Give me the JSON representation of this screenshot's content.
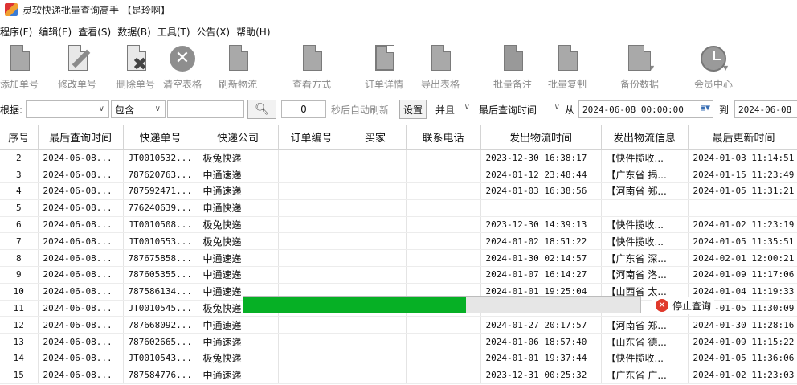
{
  "window": {
    "title": "灵软快递批量查询高手 【是玲啊】"
  },
  "menu": [
    "程序(F)",
    "编辑(E)",
    "查看(S)",
    "数据(B)",
    "工具(T)",
    "公告(X)",
    "帮助(H)"
  ],
  "toolbar": {
    "buttons": [
      {
        "label": "添加单号",
        "icon": "add-document-icon"
      },
      {
        "label": "修改单号",
        "icon": "edit-pencil-icon"
      },
      {
        "label": "删除单号",
        "icon": "delete-document-icon"
      },
      {
        "label": "清空表格",
        "icon": "clear-circle-x-icon"
      },
      {
        "label": "刷新物流",
        "icon": "refresh-document-icon"
      },
      {
        "label": "查看方式",
        "icon": "view-mode-icon"
      },
      {
        "label": "订单详情",
        "icon": "order-detail-icon"
      },
      {
        "label": "导出表格",
        "icon": "export-table-icon"
      },
      {
        "label": "批量备注",
        "icon": "batch-note-icon"
      },
      {
        "label": "批量复制",
        "icon": "batch-copy-icon"
      },
      {
        "label": "备份数据",
        "icon": "backup-icon"
      },
      {
        "label": "会员中心",
        "icon": "member-clock-icon"
      }
    ]
  },
  "filter": {
    "label": "根据:",
    "field_value": "",
    "match_mode": "包含",
    "keyword": "",
    "search_icon": "search-icon",
    "seconds": "0",
    "auto_refresh_label": "秒后自动刷新",
    "settings_label": "设置",
    "logic": "并且",
    "time_field": "最后查询时间",
    "from_label": "从",
    "from_value": "2024-06-08 00:00:00",
    "to_label": "到",
    "to_value": "2024-06-08"
  },
  "table": {
    "columns": [
      "序号",
      "最后查询时间",
      "快递单号",
      "快递公司",
      "订单编号",
      "买家",
      "联系电话",
      "发出物流时间",
      "发出物流信息",
      "最后更新时间"
    ],
    "rows": [
      [
        "2",
        "2024-06-08...",
        "JT0010532...",
        "极兔快递",
        "",
        "",
        "",
        "2023-12-30 16:38:17",
        "【快件揽收...",
        "2024-01-03 11:14:51"
      ],
      [
        "3",
        "2024-06-08...",
        "787620763...",
        "中通速递",
        "",
        "",
        "",
        "2024-01-12 23:48:44",
        "【广东省 揭...",
        "2024-01-15 11:23:49"
      ],
      [
        "4",
        "2024-06-08...",
        "787592471...",
        "中通速递",
        "",
        "",
        "",
        "2024-01-03 16:38:56",
        "【河南省 郑...",
        "2024-01-05 11:31:21"
      ],
      [
        "5",
        "2024-06-08...",
        "776240639...",
        "申通快递",
        "",
        "",
        "",
        "",
        "",
        ""
      ],
      [
        "6",
        "2024-06-08...",
        "JT0010508...",
        "极兔快递",
        "",
        "",
        "",
        "2023-12-30 14:39:13",
        "【快件揽收...",
        "2024-01-02 11:23:19"
      ],
      [
        "7",
        "2024-06-08...",
        "JT0010553...",
        "极兔快递",
        "",
        "",
        "",
        "2024-01-02 18:51:22",
        "【快件揽收...",
        "2024-01-05 11:35:51"
      ],
      [
        "8",
        "2024-06-08...",
        "787675858...",
        "中通速递",
        "",
        "",
        "",
        "2024-01-30 02:14:57",
        "【广东省 深...",
        "2024-02-01 12:00:21"
      ],
      [
        "9",
        "2024-06-08...",
        "787605355...",
        "中通速递",
        "",
        "",
        "",
        "2024-01-07 16:14:27",
        "【河南省 洛...",
        "2024-01-09 11:17:06"
      ],
      [
        "10",
        "2024-06-08...",
        "787586134...",
        "中通速递",
        "",
        "",
        "",
        "2024-01-01 19:25:04",
        "【山西省 太...",
        "2024-01-04 11:19:33"
      ],
      [
        "11",
        "2024-06-08...",
        "JT0010545...",
        "极兔快递",
        "",
        "",
        "",
        "",
        "",
        "2024-01-05 11:30:09"
      ],
      [
        "12",
        "2024-06-08...",
        "787668092...",
        "中通速递",
        "",
        "",
        "",
        "2024-01-27 20:17:57",
        "【河南省 郑...",
        "2024-01-30 11:28:16"
      ],
      [
        "13",
        "2024-06-08...",
        "787602665...",
        "中通速递",
        "",
        "",
        "",
        "2024-01-06 18:57:40",
        "【山东省 德...",
        "2024-01-09 11:15:22"
      ],
      [
        "14",
        "2024-06-08...",
        "JT0010543...",
        "极兔快递",
        "",
        "",
        "",
        "2024-01-01 19:37:44",
        "【快件揽收...",
        "2024-01-05 11:36:06"
      ],
      [
        "15",
        "2024-06-08...",
        "787584776...",
        "中通速递",
        "",
        "",
        "",
        "2023-12-31 00:25:32",
        "【广东省 广...",
        "2024-01-02 11:23:03"
      ]
    ]
  },
  "progress": {
    "fraction": 0.56,
    "fill_color": "#06b025",
    "stop_label": "停止查询",
    "stop_icon": "stop-circle-x-icon"
  }
}
